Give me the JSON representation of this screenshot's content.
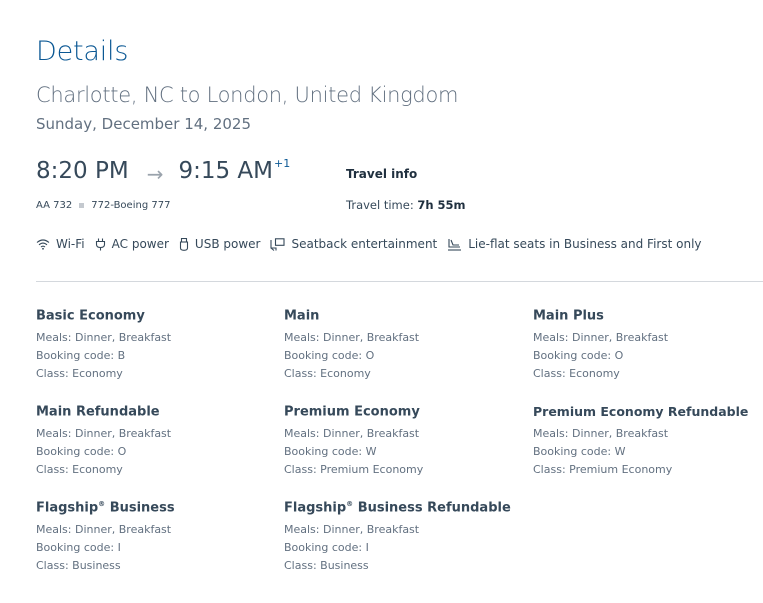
{
  "page": {
    "title": "Details"
  },
  "trip": {
    "route": "Charlotte, NC to London, United Kingdom",
    "date": "Sunday, December 14, 2025"
  },
  "flight": {
    "depart_time": "8:20 PM",
    "arrive_time": "9:15 AM",
    "day_offset": "+1",
    "flight_number": "AA 732",
    "aircraft": "772-Boeing 777"
  },
  "travel_info": {
    "heading": "Travel info",
    "time_label": "Travel time:",
    "time_value": "7h 55m"
  },
  "amenities": [
    {
      "label": "Wi-Fi",
      "icon": "wifi-icon"
    },
    {
      "label": "AC power",
      "icon": "ac-power-plug-icon"
    },
    {
      "label": "USB power",
      "icon": "usb-icon"
    },
    {
      "label": "Seatback entertainment",
      "icon": "seatback-entertainment-icon"
    },
    {
      "label": "Lie-flat seats in Business and First only",
      "icon": "lie-flat-seat-icon"
    }
  ],
  "fares": [
    {
      "name": "Basic Economy",
      "registered": "",
      "suffix": "",
      "meals": "Meals: Dinner, Breakfast",
      "booking": "Booking code: B",
      "class": "Class: Economy"
    },
    {
      "name": "Main",
      "registered": "",
      "suffix": "",
      "meals": "Meals: Dinner, Breakfast",
      "booking": "Booking code: O",
      "class": "Class: Economy"
    },
    {
      "name": "Main Plus",
      "registered": "",
      "suffix": "",
      "meals": "Meals: Dinner, Breakfast",
      "booking": "Booking code: O",
      "class": "Class: Economy"
    },
    {
      "name": "Main Refundable",
      "registered": "",
      "suffix": "",
      "meals": "Meals: Dinner, Breakfast",
      "booking": "Booking code: O",
      "class": "Class: Economy"
    },
    {
      "name": "Premium Economy",
      "registered": "",
      "suffix": "",
      "meals": "Meals: Dinner, Breakfast",
      "booking": "Booking code: W",
      "class": "Class: Premium Economy"
    },
    {
      "name": "Premium Economy Refundable",
      "registered": "",
      "suffix": "",
      "meals": "Meals: Dinner, Breakfast",
      "booking": "Booking code: W",
      "class": "Class: Premium Economy"
    },
    {
      "name": "Flagship",
      "registered": "®",
      "suffix": " Business",
      "meals": "Meals: Dinner, Breakfast",
      "booking": "Booking code: I",
      "class": "Class: Business"
    },
    {
      "name": "Flagship",
      "registered": "®",
      "suffix": " Business Refundable",
      "meals": "Meals: Dinner, Breakfast",
      "booking": "Booking code: I",
      "class": "Class: Business"
    }
  ]
}
